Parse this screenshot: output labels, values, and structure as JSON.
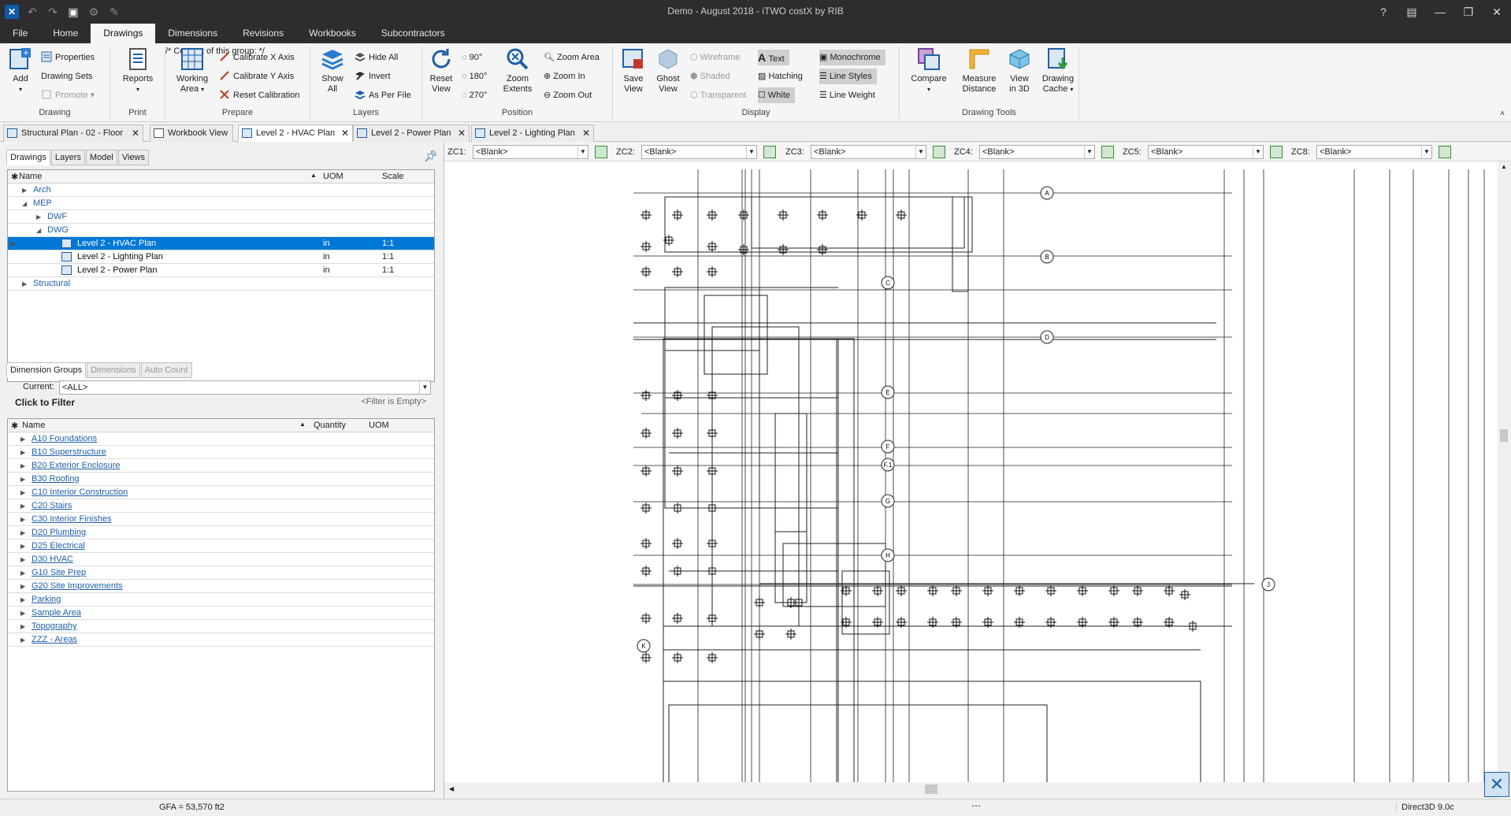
{
  "window": {
    "title": "Demo - August 2018 - iTWO costX by RIB"
  },
  "menu": {
    "tabs": [
      {
        "label": "File"
      },
      {
        "label": "Home"
      },
      {
        "label": "Drawings"
      },
      {
        "label": "Dimensions"
      },
      {
        "label": "Revisions"
      },
      {
        "label": "Workbooks"
      },
      {
        "label": "Subcontractors"
      }
    ],
    "active": "Drawings"
  },
  "ribbon": {
    "drawing": {
      "label": "Drawing",
      "add": "Add",
      "properties": "Properties",
      "drawing_sets": "Drawing Sets",
      "promote": "Promote"
    },
    "print": {
      "label": "Print",
      "reports": "Reports"
    },
    "prepare": {
      "label": "Prepare",
      "working_area_1": "Working",
      "working_area_2": "Area",
      "calibrate_x": "Calibrate X Axis",
      "calibrate_y": "Calibrate Y Axis",
      "reset_calibration": "Reset Calibration"
    },
    "layers": {
      "label": "Layers",
      "show_all_1": "Show",
      "show_all_2": "All",
      "hide_all": "Hide All",
      "invert": "Invert",
      "as_per_file": "As Per File"
    },
    "position": {
      "label": "Position",
      "reset_view_1": "Reset",
      "reset_view_2": "View",
      "rot90": "90°",
      "rot180": "180°",
      "rot270": "270°",
      "zoom_extents_1": "Zoom",
      "zoom_extents_2": "Extents",
      "zoom_area": "Zoom Area",
      "zoom_in": "Zoom In",
      "zoom_out": "Zoom Out"
    },
    "display": {
      "label": "Display",
      "save_view_1": "Save",
      "save_view_2": "View",
      "ghost_view_1": "Ghost",
      "ghost_view_2": "View",
      "wireframe": "Wireframe",
      "shaded": "Shaded",
      "transparent": "Transparent",
      "text": "Text",
      "hatching": "Hatching",
      "white": "White",
      "monochrome": "Monochrome",
      "line_styles": "Line Styles",
      "line_weight": "Line Weight"
    },
    "drawing_tools": {
      "label": "Drawing Tools",
      "compare": "Compare",
      "measure_1": "Measure",
      "measure_2": "Distance",
      "view3d_1": "View",
      "view3d_2": "in 3D",
      "cache_1": "Drawing",
      "cache_2": "Cache"
    }
  },
  "doc_tabs": [
    {
      "label": "Structural Plan - 02 - Floor"
    },
    {
      "label": "Workbook View"
    },
    {
      "label": "Level 2 - HVAC Plan"
    },
    {
      "label": "Level 2 - Power Plan"
    },
    {
      "label": "Level 2 - Lighting Plan"
    }
  ],
  "left_panel": {
    "tabs": [
      "Drawings",
      "Layers",
      "Model",
      "Views"
    ],
    "tree_columns": {
      "name": "Name",
      "uom": "UOM",
      "scale": "Scale"
    },
    "tree": [
      {
        "label": "Arch"
      },
      {
        "label": "MEP"
      },
      {
        "label": "DWF"
      },
      {
        "label": "DWG"
      },
      {
        "label": "Level 2 - HVAC Plan",
        "uom": "in",
        "scale": "1:1"
      },
      {
        "label": "Level 2 - Lighting Plan",
        "uom": "in",
        "scale": "1:1"
      },
      {
        "label": "Level 2 - Power Plan",
        "uom": "in",
        "scale": "1:1"
      },
      {
        "label": "Structural"
      }
    ],
    "dim_tabs": [
      "Dimension Groups",
      "Dimensions",
      "Auto Count"
    ],
    "current_label": "Current:",
    "current_value": "<ALL>",
    "click_to_filter": "Click to Filter",
    "filter_empty": "<Filter is Empty>",
    "dim_columns": {
      "name": "Name",
      "quantity": "Quantity",
      "uom": "UOM"
    },
    "dim_groups": [
      "A10 Foundations",
      "B10 Superstructure",
      "B20 Exterior Enclosure",
      "B30 Roofing",
      "C10 Interior Construction",
      "C20 Stairs",
      "C30 Interior Finishes",
      "D20 Plumbing",
      "D25 Electrical",
      "D30 HVAC",
      "G10 Site Prep",
      "G20 Site Improvements",
      "Parking",
      "Sample Area",
      "Topography",
      "ZZZ - Areas"
    ]
  },
  "zc_filters": [
    {
      "label": "ZC1:",
      "value": "<Blank>"
    },
    {
      "label": "ZC2:",
      "value": "<Blank>"
    },
    {
      "label": "ZC3:",
      "value": "<Blank>"
    },
    {
      "label": "ZC4:",
      "value": "<Blank>"
    },
    {
      "label": "ZC5:",
      "value": "<Blank>"
    },
    {
      "label": "ZC8:",
      "value": "<Blank>"
    }
  ],
  "grid_labels": [
    "A",
    "B",
    "C",
    "D",
    "E",
    "F",
    "F.1",
    "G",
    "H",
    "J",
    "K"
  ],
  "status": {
    "gfa": "GFA = 53,570 ft2",
    "renderer": "Direct3D 9.0c"
  }
}
